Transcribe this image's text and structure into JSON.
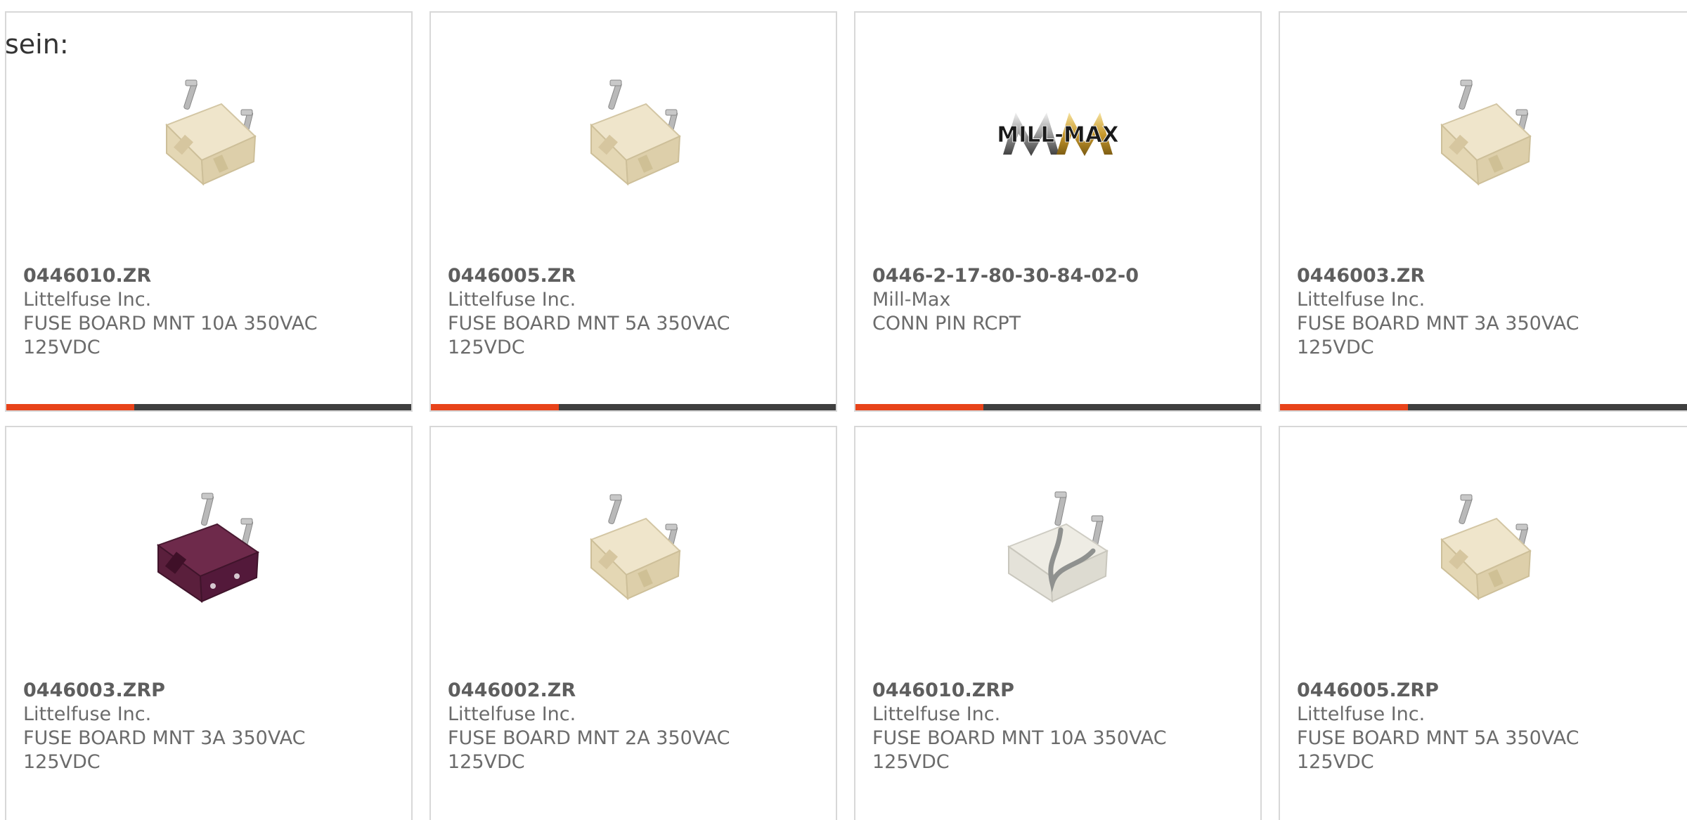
{
  "page": {
    "prefix_text": "sein:"
  },
  "colors": {
    "accent": "#e8431a",
    "bar_dark": "#3f3f3f",
    "card_border": "#d8d8d8",
    "text": "#6b6b6b"
  },
  "products": [
    {
      "part_number": "0446010.ZR",
      "manufacturer": "Littelfuse Inc.",
      "description": "FUSE BOARD MNT 10A 350VAC\n125VDC",
      "image": "fuse-beige-icon"
    },
    {
      "part_number": "0446005.ZR",
      "manufacturer": "Littelfuse Inc.",
      "description": "FUSE BOARD MNT 5A 350VAC\n125VDC",
      "image": "fuse-beige-icon"
    },
    {
      "part_number": "0446-2-17-80-30-84-02-0",
      "manufacturer": "Mill-Max",
      "description": "CONN PIN RCPT",
      "image": "mill-max-logo",
      "logo_text": "MILL-MAX"
    },
    {
      "part_number": "0446003.ZR",
      "manufacturer": "Littelfuse Inc.",
      "description": "FUSE BOARD MNT 3A 350VAC\n125VDC",
      "image": "fuse-beige-icon"
    },
    {
      "part_number": "0446003.ZRP",
      "manufacturer": "Littelfuse Inc.",
      "description": "FUSE BOARD MNT 3A 350VAC\n125VDC",
      "image": "fuse-purple-icon"
    },
    {
      "part_number": "0446002.ZR",
      "manufacturer": "Littelfuse Inc.",
      "description": "FUSE BOARD MNT 2A 350VAC\n125VDC",
      "image": "fuse-beige-icon"
    },
    {
      "part_number": "0446010.ZRP",
      "manufacturer": "Littelfuse Inc.",
      "description": "FUSE BOARD MNT 10A 350VAC\n125VDC",
      "image": "fuse-clear-icon"
    },
    {
      "part_number": "0446005.ZRP",
      "manufacturer": "Littelfuse Inc.",
      "description": "FUSE BOARD MNT 5A 350VAC\n125VDC",
      "image": "fuse-beige-icon"
    }
  ]
}
